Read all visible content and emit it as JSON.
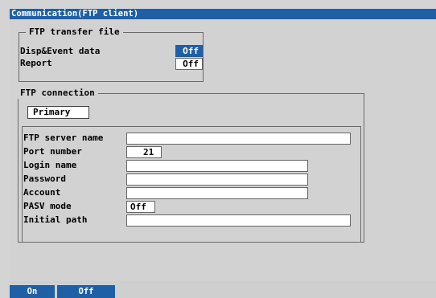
{
  "window": {
    "title": "Communication(FTP client)"
  },
  "transfer_group": {
    "title": "FTP transfer file",
    "rows": [
      {
        "label": "Disp&Event data",
        "value": "Off"
      },
      {
        "label": "Report",
        "value": "Off"
      }
    ]
  },
  "connection_group": {
    "title": "FTP connection",
    "tab": "Primary",
    "fields": [
      {
        "label": "FTP server name",
        "value": ""
      },
      {
        "label": "Port number",
        "value": "21"
      },
      {
        "label": "Login name",
        "value": ""
      },
      {
        "label": "Password",
        "value": ""
      },
      {
        "label": "Account",
        "value": ""
      },
      {
        "label": "PASV mode",
        "value": "Off"
      },
      {
        "label": "Initial path",
        "value": ""
      }
    ]
  },
  "softkeys": [
    {
      "label": "On"
    },
    {
      "label": "Off"
    }
  ],
  "colors": {
    "accent": "#1f5fa6",
    "background": "#d2d2d2",
    "field": "#ffffff"
  }
}
